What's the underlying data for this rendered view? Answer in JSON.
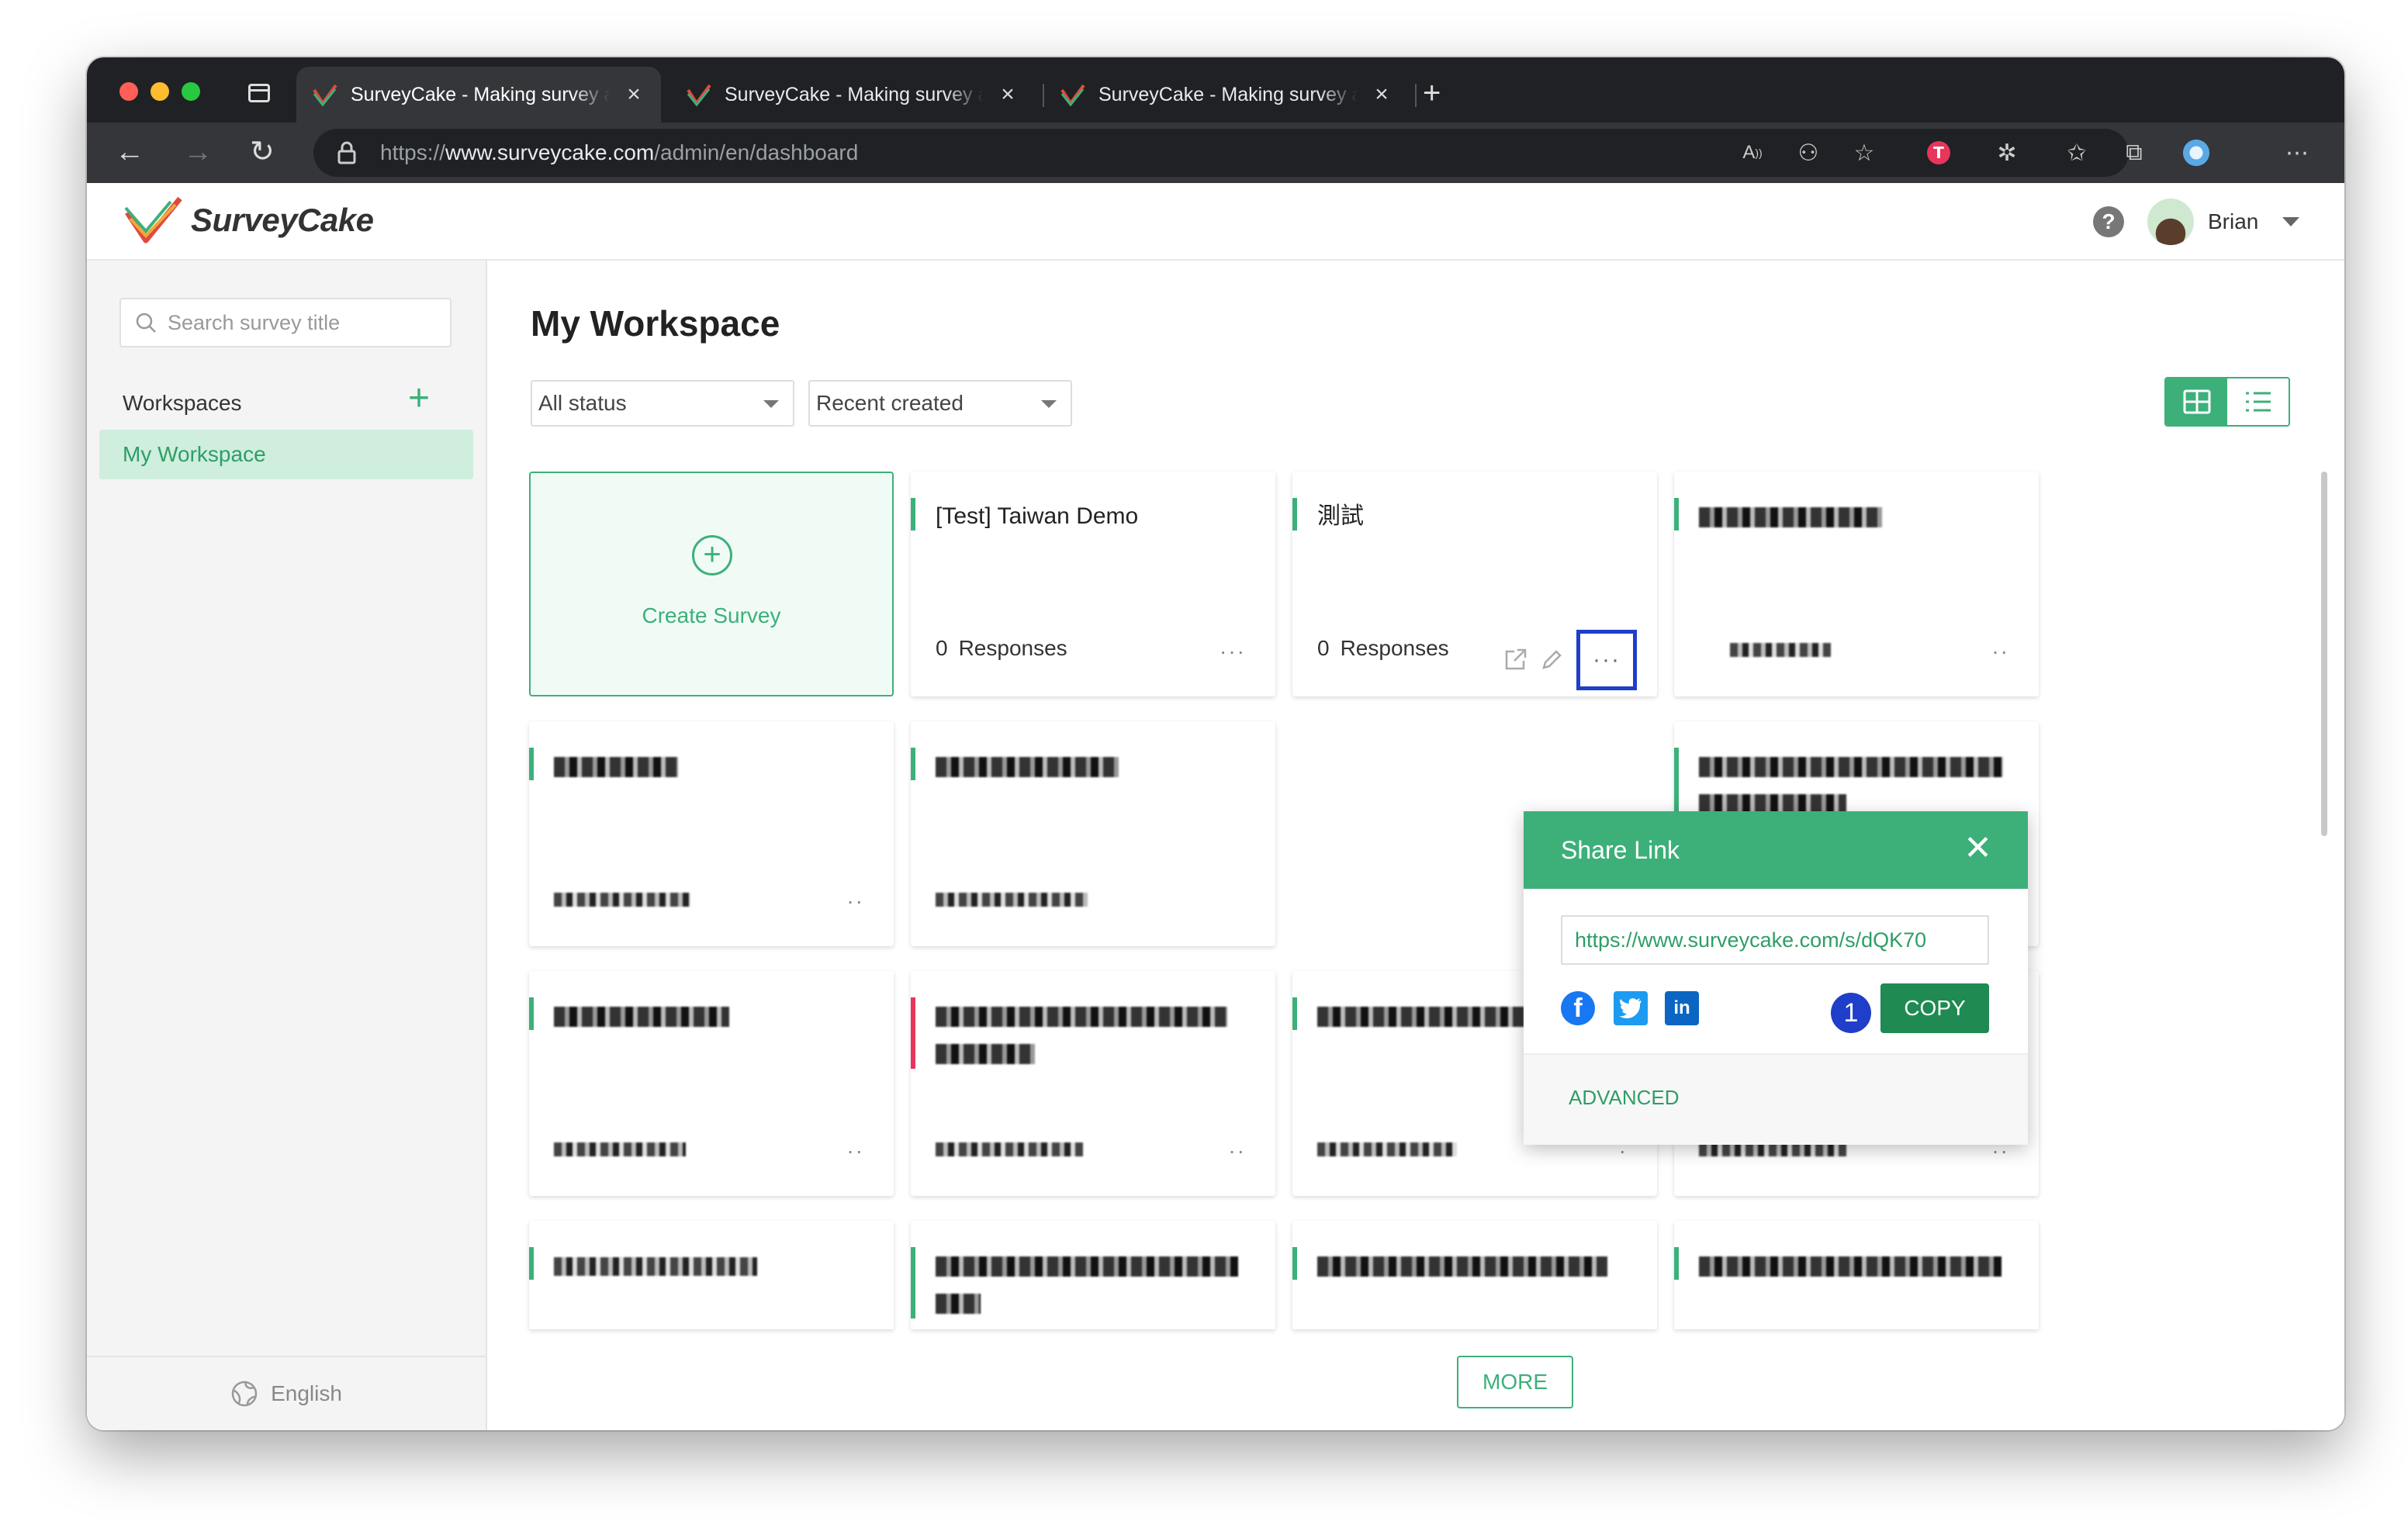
{
  "browser": {
    "tabs": [
      {
        "title": "SurveyCake - Making survey a"
      },
      {
        "title": "SurveyCake - Making survey a"
      },
      {
        "title": "SurveyCake - Making survey a"
      }
    ],
    "url": {
      "scheme": "https://",
      "host": "www.surveycake.com",
      "path": "/admin/en/dashboard"
    }
  },
  "header": {
    "logo_text": "SurveyCake",
    "user_name": "Brian"
  },
  "sidebar": {
    "search_placeholder": "Search survey title",
    "workspaces_label": "Workspaces",
    "add_symbol": "+",
    "items": [
      {
        "label": "My Workspace"
      }
    ],
    "language": "English"
  },
  "main": {
    "title": "My Workspace",
    "status_filter": "All status",
    "sort_filter": "Recent created",
    "create_label": "Create Survey",
    "more_label": "MORE",
    "cards": [
      {
        "title": "[Test] Taiwan Demo",
        "responses_count": "0",
        "responses_label": "Responses"
      },
      {
        "title": "測試",
        "responses_count": "0",
        "responses_label": "Responses"
      }
    ]
  },
  "share_popup": {
    "title": "Share Link",
    "url": "https://www.surveycake.com/s/dQK70",
    "step_number": "1",
    "copy_label": "COPY",
    "advanced_label": "ADVANCED",
    "social": [
      "facebook",
      "twitter",
      "linkedin"
    ]
  },
  "colors": {
    "brand_green": "#3db07a",
    "copy_green": "#1f8a52",
    "highlight_blue": "#1f3ec9",
    "selected_item_bg": "#cfeedd"
  }
}
